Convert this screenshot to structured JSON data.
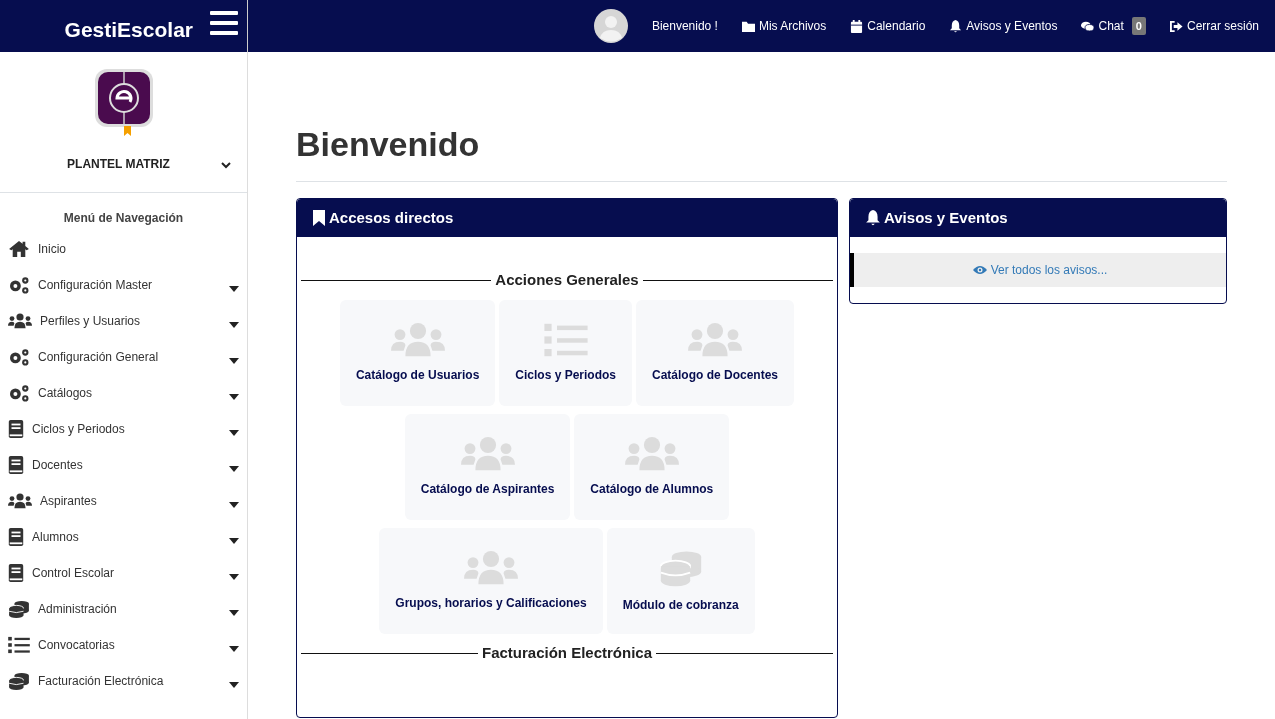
{
  "brand": {
    "title": "GestiEscolar"
  },
  "topbar": {
    "items": [
      {
        "kind": "greeting",
        "label": "Bienvenido !"
      },
      {
        "kind": "folder",
        "label": "Mis Archivos"
      },
      {
        "kind": "calendar",
        "label": "Calendario"
      },
      {
        "kind": "bell",
        "label": "Avisos y Eventos"
      },
      {
        "kind": "chat",
        "label": "Chat",
        "badge": "0"
      },
      {
        "kind": "logout",
        "label": "Cerrar sesión"
      }
    ]
  },
  "sidebar": {
    "campus": "PLANTEL MATRIZ",
    "menu_title": "Menú de Navegación",
    "items": [
      {
        "kind": "home",
        "label": "Inicio",
        "submenu": false
      },
      {
        "kind": "gears",
        "label": "Configuración Master",
        "submenu": true
      },
      {
        "kind": "users",
        "label": "Perfiles y Usuarios",
        "submenu": true
      },
      {
        "kind": "gears",
        "label": "Configuración General",
        "submenu": true
      },
      {
        "kind": "gears",
        "label": "Catálogos",
        "submenu": true
      },
      {
        "kind": "book",
        "label": "Ciclos y Periodos",
        "submenu": true
      },
      {
        "kind": "book",
        "label": "Docentes",
        "submenu": true
      },
      {
        "kind": "users",
        "label": "Aspirantes",
        "submenu": true
      },
      {
        "kind": "book",
        "label": "Alumnos",
        "submenu": true
      },
      {
        "kind": "book",
        "label": "Control Escolar",
        "submenu": true
      },
      {
        "kind": "coins",
        "label": "Administración",
        "submenu": true
      },
      {
        "kind": "list",
        "label": "Convocatorias",
        "submenu": true
      },
      {
        "kind": "coins",
        "label": "Facturación Electrónica",
        "submenu": true
      }
    ]
  },
  "page": {
    "title": "Bienvenido"
  },
  "shortcuts": {
    "title": "Accesos directos",
    "sections": [
      {
        "title": "Acciones Generales",
        "rows": [
          [
            {
              "kind": "users",
              "label": "Catálogo de Usuarios"
            },
            {
              "kind": "list",
              "label": "Ciclos y Periodos"
            },
            {
              "kind": "users",
              "label": "Catálogo de Docentes"
            }
          ],
          [
            {
              "kind": "users",
              "label": "Catálogo de Aspirantes"
            },
            {
              "kind": "users",
              "label": "Catálogo de Alumnos"
            }
          ],
          [
            {
              "kind": "users",
              "label": "Grupos, horarios y Calificaciones"
            },
            {
              "kind": "coins",
              "label": "Módulo de cobranza"
            }
          ]
        ]
      },
      {
        "title": "Facturación Electrónica"
      }
    ]
  },
  "notices": {
    "title": "Avisos y Eventos",
    "link": "Ver todos los avisos..."
  }
}
